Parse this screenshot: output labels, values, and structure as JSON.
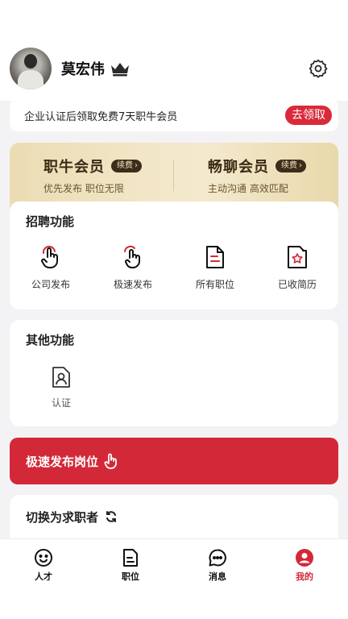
{
  "profile": {
    "name": "莫宏伟"
  },
  "promo": {
    "text": "企业认证后领取免费7天职牛会员",
    "button": "去领取"
  },
  "membership": [
    {
      "title": "职牛会员",
      "badge": "续费",
      "subtitle": "优先发布 职位无限"
    },
    {
      "title": "畅聊会员",
      "badge": "续费",
      "subtitle": "主动沟通 高效匹配"
    }
  ],
  "recruit": {
    "title": "招聘功能",
    "items": [
      {
        "label": "公司发布",
        "icon": "hand-pointer-icon"
      },
      {
        "label": "极速发布",
        "icon": "fast-tap-icon"
      },
      {
        "label": "所有职位",
        "icon": "document-icon"
      },
      {
        "label": "已收简历",
        "icon": "starred-file-icon"
      }
    ]
  },
  "other": {
    "title": "其他功能",
    "items": [
      {
        "label": "认证",
        "icon": "id-card-icon"
      }
    ]
  },
  "quick_post": {
    "label": "极速发布岗位"
  },
  "switch_role": {
    "label": "切换为求职者"
  },
  "tabbar": {
    "items": [
      {
        "label": "人才",
        "icon": "smile-icon"
      },
      {
        "label": "职位",
        "icon": "document-icon"
      },
      {
        "label": "消息",
        "icon": "chat-icon"
      },
      {
        "label": "我的",
        "icon": "user-icon"
      }
    ],
    "active_color": "#d32838"
  },
  "colors": {
    "accent": "#d92a3a",
    "member_gold": "#ebdcb3"
  }
}
